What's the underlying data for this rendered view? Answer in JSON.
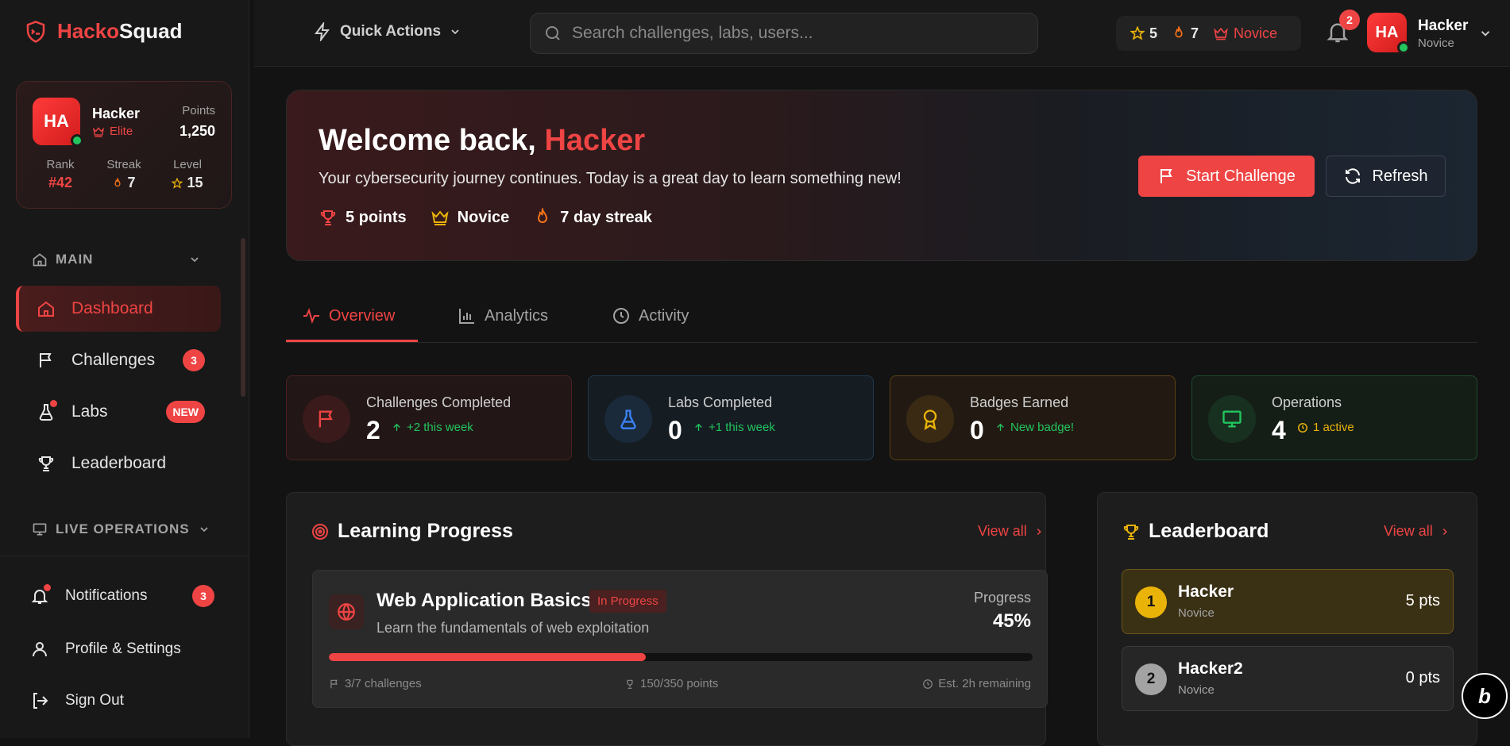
{
  "app": {
    "brand_a": "Hacko",
    "brand_b": "Squad"
  },
  "profile_card": {
    "avatar_initials": "HA",
    "name": "Hacker",
    "title": "Elite",
    "points_label": "Points",
    "points": "1,250",
    "stats": [
      {
        "label": "Rank",
        "value": "#42"
      },
      {
        "label": "Streak",
        "value": "7"
      },
      {
        "label": "Level",
        "value": "15"
      }
    ]
  },
  "sidebar": {
    "main_section": "MAIN",
    "items": [
      {
        "label": "Dashboard",
        "icon": "home-icon",
        "active": true
      },
      {
        "label": "Challenges",
        "icon": "flag-icon",
        "badge": "3"
      },
      {
        "label": "Labs",
        "icon": "flask-icon",
        "badge": "NEW"
      },
      {
        "label": "Leaderboard",
        "icon": "trophy-icon"
      }
    ],
    "live_section": "LIVE OPERATIONS",
    "bottom": [
      {
        "label": "Notifications",
        "icon": "bell-icon",
        "badge": "3"
      },
      {
        "label": "Profile & Settings",
        "icon": "user-icon"
      },
      {
        "label": "Sign Out",
        "icon": "logout-icon"
      }
    ]
  },
  "topbar": {
    "quick_actions": "Quick Actions",
    "search_placeholder": "Search challenges, labs, users...",
    "stars": "5",
    "streak": "7",
    "rank": "Novice",
    "notifications_count": "2",
    "user_initials": "HA",
    "user_name": "Hacker",
    "user_rank": "Novice"
  },
  "hero": {
    "greeting": "Welcome back, ",
    "name": "Hacker",
    "subtitle": "Your cybersecurity journey continues. Today is a great day to learn something new!",
    "stats": [
      "5 points",
      "Novice",
      "7 day streak"
    ],
    "start_button": "Start Challenge",
    "refresh_button": "Refresh"
  },
  "tabs": [
    "Overview",
    "Analytics",
    "Activity"
  ],
  "stat_cards": [
    {
      "label": "Challenges Completed",
      "value": "2",
      "delta": "+2 this week",
      "color": "#ef4444"
    },
    {
      "label": "Labs Completed",
      "value": "0",
      "delta": "+1 this week",
      "color": "#3b82f6"
    },
    {
      "label": "Badges Earned",
      "value": "0",
      "delta": "New badge!",
      "color": "#eab308"
    },
    {
      "label": "Operations",
      "value": "4",
      "delta": "1 active",
      "color": "#22c55e"
    }
  ],
  "learning": {
    "title": "Learning Progress",
    "view_all": "View all",
    "course": {
      "title": "Web Application Basics",
      "status": "In Progress",
      "description": "Learn the fundamentals of web exploitation",
      "progress_label": "Progress",
      "progress": "45%",
      "progress_fraction": 0.45,
      "challenges": "3/7 challenges",
      "points": "150/350 points",
      "remaining": "Est. 2h remaining"
    }
  },
  "leaderboard": {
    "title": "Leaderboard",
    "view_all": "View all",
    "rows": [
      {
        "rank": "1",
        "name": "Hacker",
        "title": "Novice",
        "points": "5 pts"
      },
      {
        "rank": "2",
        "name": "Hacker2",
        "title": "Novice",
        "points": "0 pts"
      }
    ]
  },
  "colors": {
    "accent": "#ef4444",
    "gold": "#eab308",
    "green": "#22c55e",
    "blue": "#3b82f6",
    "background": "#131313"
  }
}
